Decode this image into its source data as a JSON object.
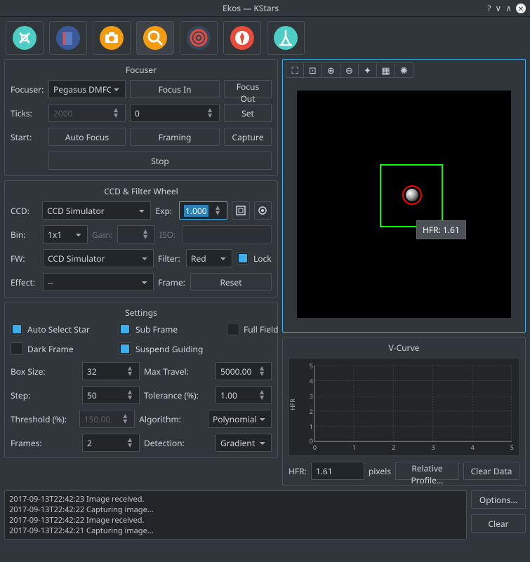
{
  "window": {
    "title": "Ekos — KStars"
  },
  "focuser": {
    "title": "Focuser",
    "focuser_label": "Focuser:",
    "focuser_device": "Pegasus DMFC",
    "focus_in": "Focus In",
    "focus_out": "Focus Out",
    "ticks_label": "Ticks:",
    "ticks_current": "2000",
    "ticks_target": "0",
    "set": "Set",
    "start_label": "Start:",
    "auto_focus": "Auto Focus",
    "framing": "Framing",
    "capture": "Capture",
    "stop": "Stop"
  },
  "ccd": {
    "title": "CCD & Filter Wheel",
    "ccd_label": "CCD:",
    "ccd_device": "CCD Simulator",
    "exp_label": "Exp:",
    "exp_value": "1.000",
    "bin_label": "Bin:",
    "bin_value": "1x1",
    "gain_label": "Gain:",
    "gain_value": "",
    "iso_label": "ISO:",
    "iso_value": "",
    "fw_label": "FW:",
    "fw_device": "CCD Simulator",
    "filter_label": "Filter:",
    "filter_value": "Red",
    "lock_label": "Lock",
    "effect_label": "Effect:",
    "effect_value": "--",
    "frame_label": "Frame:",
    "reset": "Reset"
  },
  "settings": {
    "title": "Settings",
    "auto_select_star": "Auto Select Star",
    "sub_frame": "Sub Frame",
    "full_field": "Full Field",
    "dark_frame": "Dark Frame",
    "suspend_guiding": "Suspend Guiding",
    "box_size_label": "Box Size:",
    "box_size": "32",
    "max_travel_label": "Max Travel:",
    "max_travel": "5000.00",
    "step_label": "Step:",
    "step": "50",
    "tolerance_label": "Tolerance (%):",
    "tolerance": "1.00",
    "threshold_label": "Threshold (%):",
    "threshold": "150.00",
    "algorithm_label": "Algorithm:",
    "algorithm": "Polynomial",
    "frames_label": "Frames:",
    "frames": "2",
    "detection_label": "Detection:",
    "detection": "Gradient"
  },
  "preview": {
    "hfr_badge": "HFR: 1.61"
  },
  "vcurve": {
    "title": "V-Curve",
    "hfr_label": "HFR:",
    "hfr_value": "1.61",
    "pixels_label": "pixels",
    "relative_profile": "Relative Profile...",
    "clear_data": "Clear Data"
  },
  "chart_data": {
    "type": "line",
    "title": "V-Curve",
    "xlabel": "",
    "ylabel": "HFR",
    "xlim": [
      0,
      5
    ],
    "ylim": [
      0,
      5
    ],
    "xticks": [
      0,
      1,
      2,
      3,
      4,
      5
    ],
    "yticks": [
      0,
      1,
      2,
      3,
      4,
      5
    ],
    "series": []
  },
  "log": {
    "lines": [
      "2017-09-13T22:42:23 Image received.",
      "2017-09-13T22:42:22 Capturing image...",
      "2017-09-13T22:42:22 Image received.",
      "2017-09-13T22:42:21 Capturing image..."
    ],
    "options": "Options...",
    "clear": "Clear"
  }
}
